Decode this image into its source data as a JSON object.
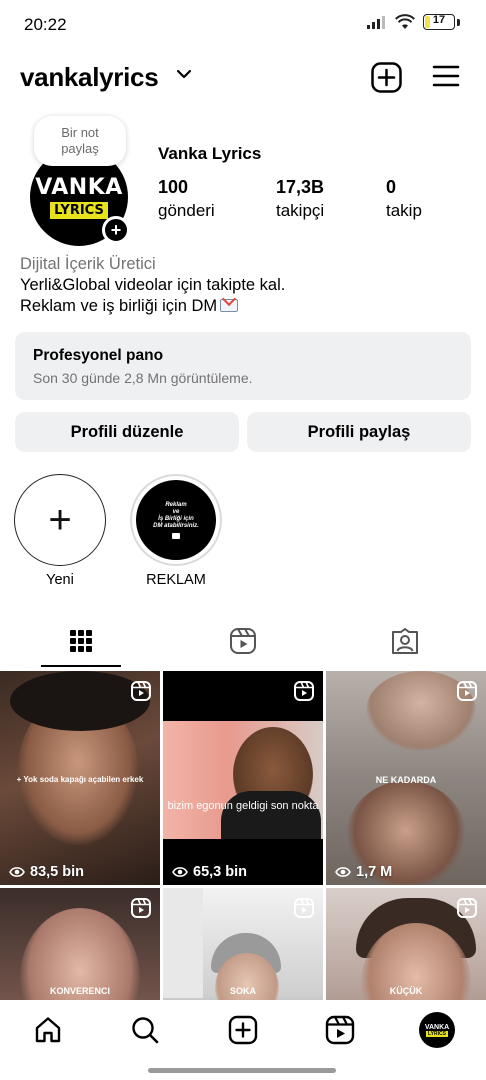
{
  "status_bar": {
    "time": "20:22",
    "battery": "17",
    "battery_level": 0.17
  },
  "header": {
    "username": "vankalyrics",
    "icons": [
      "chevron-down-icon",
      "add-square-icon",
      "hamburger-menu-icon"
    ]
  },
  "profile": {
    "note": [
      "Bir not",
      "paylaş"
    ],
    "avatar_text": [
      "VANKA",
      "LYRICS"
    ],
    "display_name": "Vanka Lyrics",
    "stats": [
      {
        "value": "100",
        "label": "gönderi"
      },
      {
        "value": "17,3B",
        "label": "takipçi"
      },
      {
        "value": "0",
        "label": "takip"
      }
    ],
    "category": "Dijital İçerik Üretici",
    "bio_line1": "Yerli&Global videolar için takipte kal.",
    "bio_line2": "Reklam ve iş birliği için DM"
  },
  "pro_panel": {
    "title": "Profesyonel pano",
    "subtitle": "Son 30 günde 2,8 Mn görüntüleme."
  },
  "buttons": {
    "edit": "Profili düzenle",
    "share": "Profili paylaş"
  },
  "highlights": [
    {
      "label": "Yeni"
    },
    {
      "label": "REKLAM",
      "cover_text": [
        "Reklam",
        "ve",
        "İş Birliği için",
        "DM atabilirsiniz."
      ]
    }
  ],
  "tabs": [
    "grid-icon",
    "reels-icon",
    "tagged-icon"
  ],
  "posts": [
    {
      "views": "83,5 bin",
      "caption": "+ Yok soda kapağı açabilen erkek"
    },
    {
      "views": "65,3 bin",
      "caption": "bizim egonun geldigi son nokta"
    },
    {
      "views": "1,7 M",
      "caption": "NE KADARDA"
    },
    {
      "caption": "KONVERENCI"
    },
    {
      "caption": "SOKA"
    },
    {
      "caption": "KÜÇÜK"
    }
  ],
  "bottom_nav": [
    "home-icon",
    "search-icon",
    "create-icon",
    "reels-icon",
    "profile-avatar"
  ],
  "colors": {
    "panel_bg": "#eff0f2",
    "secondary_text": "#737373",
    "brand_yellow": "#e6e21c"
  }
}
